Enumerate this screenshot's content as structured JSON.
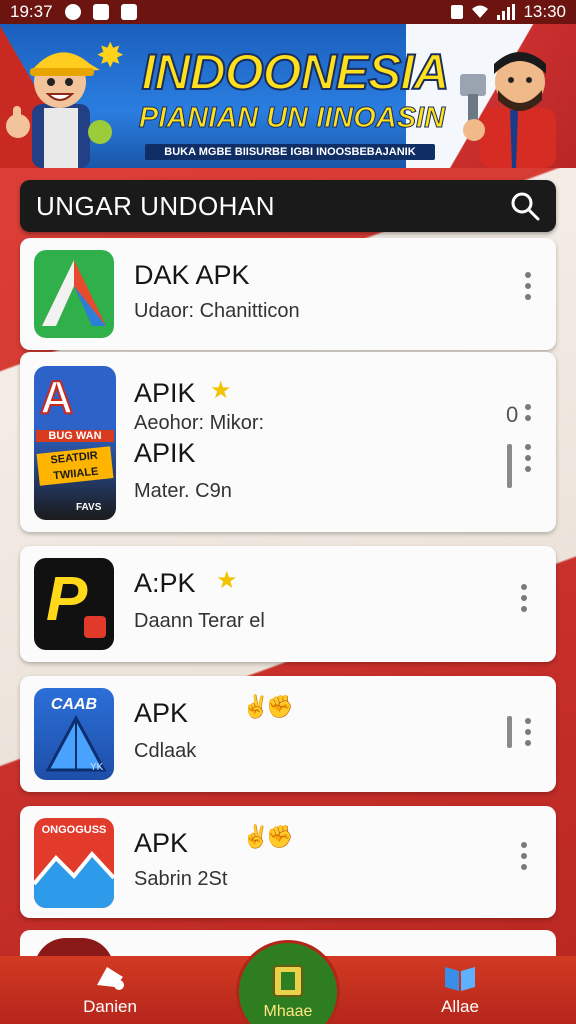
{
  "status_bar": {
    "time_left": "19:37",
    "time_right": "13:30"
  },
  "banner": {
    "title": "INDOONESIA",
    "subtitle": "PIANIAN UN IINOASIN",
    "tagline": "BUKA MGBE BIISURBE IGBI INOOSBEBAJANIK"
  },
  "search": {
    "text": "UNGAR UNDOHAN"
  },
  "apps": [
    {
      "name": "DAK APK",
      "sub": "Udaor: Chanitticon"
    },
    {
      "name": "APIK",
      "sub": "Aeohor: Mikor:",
      "name2": "APIK",
      "sub2": "Mater. C9n",
      "count": "0",
      "icon_text_top": "BUG WAN",
      "icon_text_mid": "SEATDIR TWIIALE",
      "icon_text_bot": "FAVS"
    },
    {
      "name": "A:PK",
      "sub": "Daann Terar el",
      "icon_letter": "P"
    },
    {
      "name": "APK",
      "sub": "Cdlaak",
      "icon_text": "CAAB",
      "icon_corner": "YK"
    },
    {
      "name": "APK",
      "sub": "Sabrin 2St",
      "icon_text": "ONGOGUSS"
    }
  ],
  "nav": {
    "left_label": "Danien",
    "center_label": "Mhaae",
    "right_label": "Allae"
  },
  "colors": {
    "accent_red": "#d23a22",
    "banner_blue": "#1b5fbd",
    "title_yellow": "#ffe01c",
    "nav_green": "#2e7d20"
  }
}
